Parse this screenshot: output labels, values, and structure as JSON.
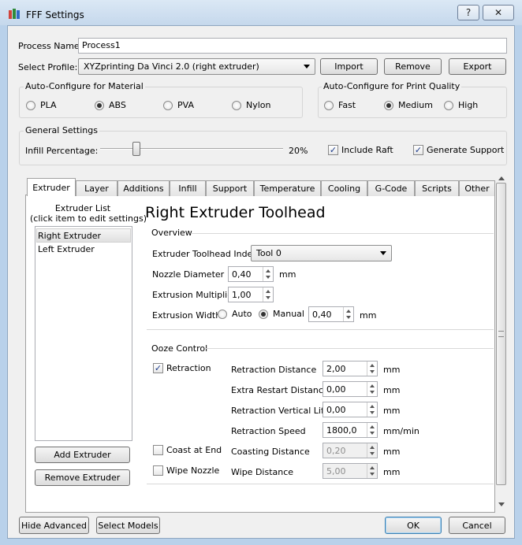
{
  "window": {
    "title": "FFF Settings",
    "help_label": "?",
    "close_label": "✕"
  },
  "process": {
    "label": "Process Name:",
    "value": "Process1"
  },
  "profile": {
    "label": "Select Profile:",
    "value": "XYZprinting Da Vinci 2.0 (right extruder)",
    "import_label": "Import",
    "remove_label": "Remove",
    "export_label": "Export"
  },
  "material": {
    "title": "Auto-Configure for Material",
    "options": [
      "PLA",
      "ABS",
      "PVA",
      "Nylon"
    ],
    "selected": "ABS"
  },
  "quality": {
    "title": "Auto-Configure for Print Quality",
    "options": [
      "Fast",
      "Medium",
      "High"
    ],
    "selected": "Medium"
  },
  "general": {
    "title": "General Settings",
    "infill_label": "Infill Percentage:",
    "infill_value_text": "20%",
    "infill_fraction": 0.2,
    "include_raft_label": "Include Raft",
    "generate_support_label": "Generate Support"
  },
  "tabs": [
    "Extruder",
    "Layer",
    "Additions",
    "Infill",
    "Support",
    "Temperature",
    "Cooling",
    "G-Code",
    "Scripts",
    "Other"
  ],
  "extruder_list": {
    "title_line1": "Extruder List",
    "title_line2": "(click item to edit settings)",
    "items": [
      "Right Extruder",
      "Left Extruder"
    ],
    "add_label": "Add Extruder",
    "remove_label": "Remove Extruder"
  },
  "toolhead": {
    "heading": "Right Extruder Toolhead"
  },
  "overview": {
    "title": "Overview",
    "index_label": "Extruder Toolhead Index",
    "index_value": "Tool 0",
    "nozzle_label": "Nozzle Diameter",
    "nozzle_value": "0,40",
    "nozzle_unit": "mm",
    "mult_label": "Extrusion Multiplier",
    "mult_value": "1,00",
    "width_label": "Extrusion Width",
    "auto_label": "Auto",
    "manual_label": "Manual",
    "width_value": "0,40",
    "width_unit": "mm"
  },
  "ooze": {
    "title": "Ooze Control",
    "retraction_label": "Retraction",
    "coast_label": "Coast at End",
    "wipe_label": "Wipe Nozzle",
    "fields": [
      {
        "label": "Retraction Distance",
        "value": "2,00",
        "unit": "mm"
      },
      {
        "label": "Extra Restart Distance",
        "value": "0,00",
        "unit": "mm"
      },
      {
        "label": "Retraction Vertical Lift",
        "value": "0,00",
        "unit": "mm"
      },
      {
        "label": "Retraction Speed",
        "value": "1800,0",
        "unit": "mm/min"
      },
      {
        "label": "Coasting Distance",
        "value": "0,20",
        "unit": "mm"
      },
      {
        "label": "Wipe Distance",
        "value": "5,00",
        "unit": "mm"
      }
    ]
  },
  "footer": {
    "hide_advanced_label": "Hide Advanced",
    "select_models_label": "Select Models",
    "ok_label": "OK",
    "cancel_label": "Cancel"
  }
}
